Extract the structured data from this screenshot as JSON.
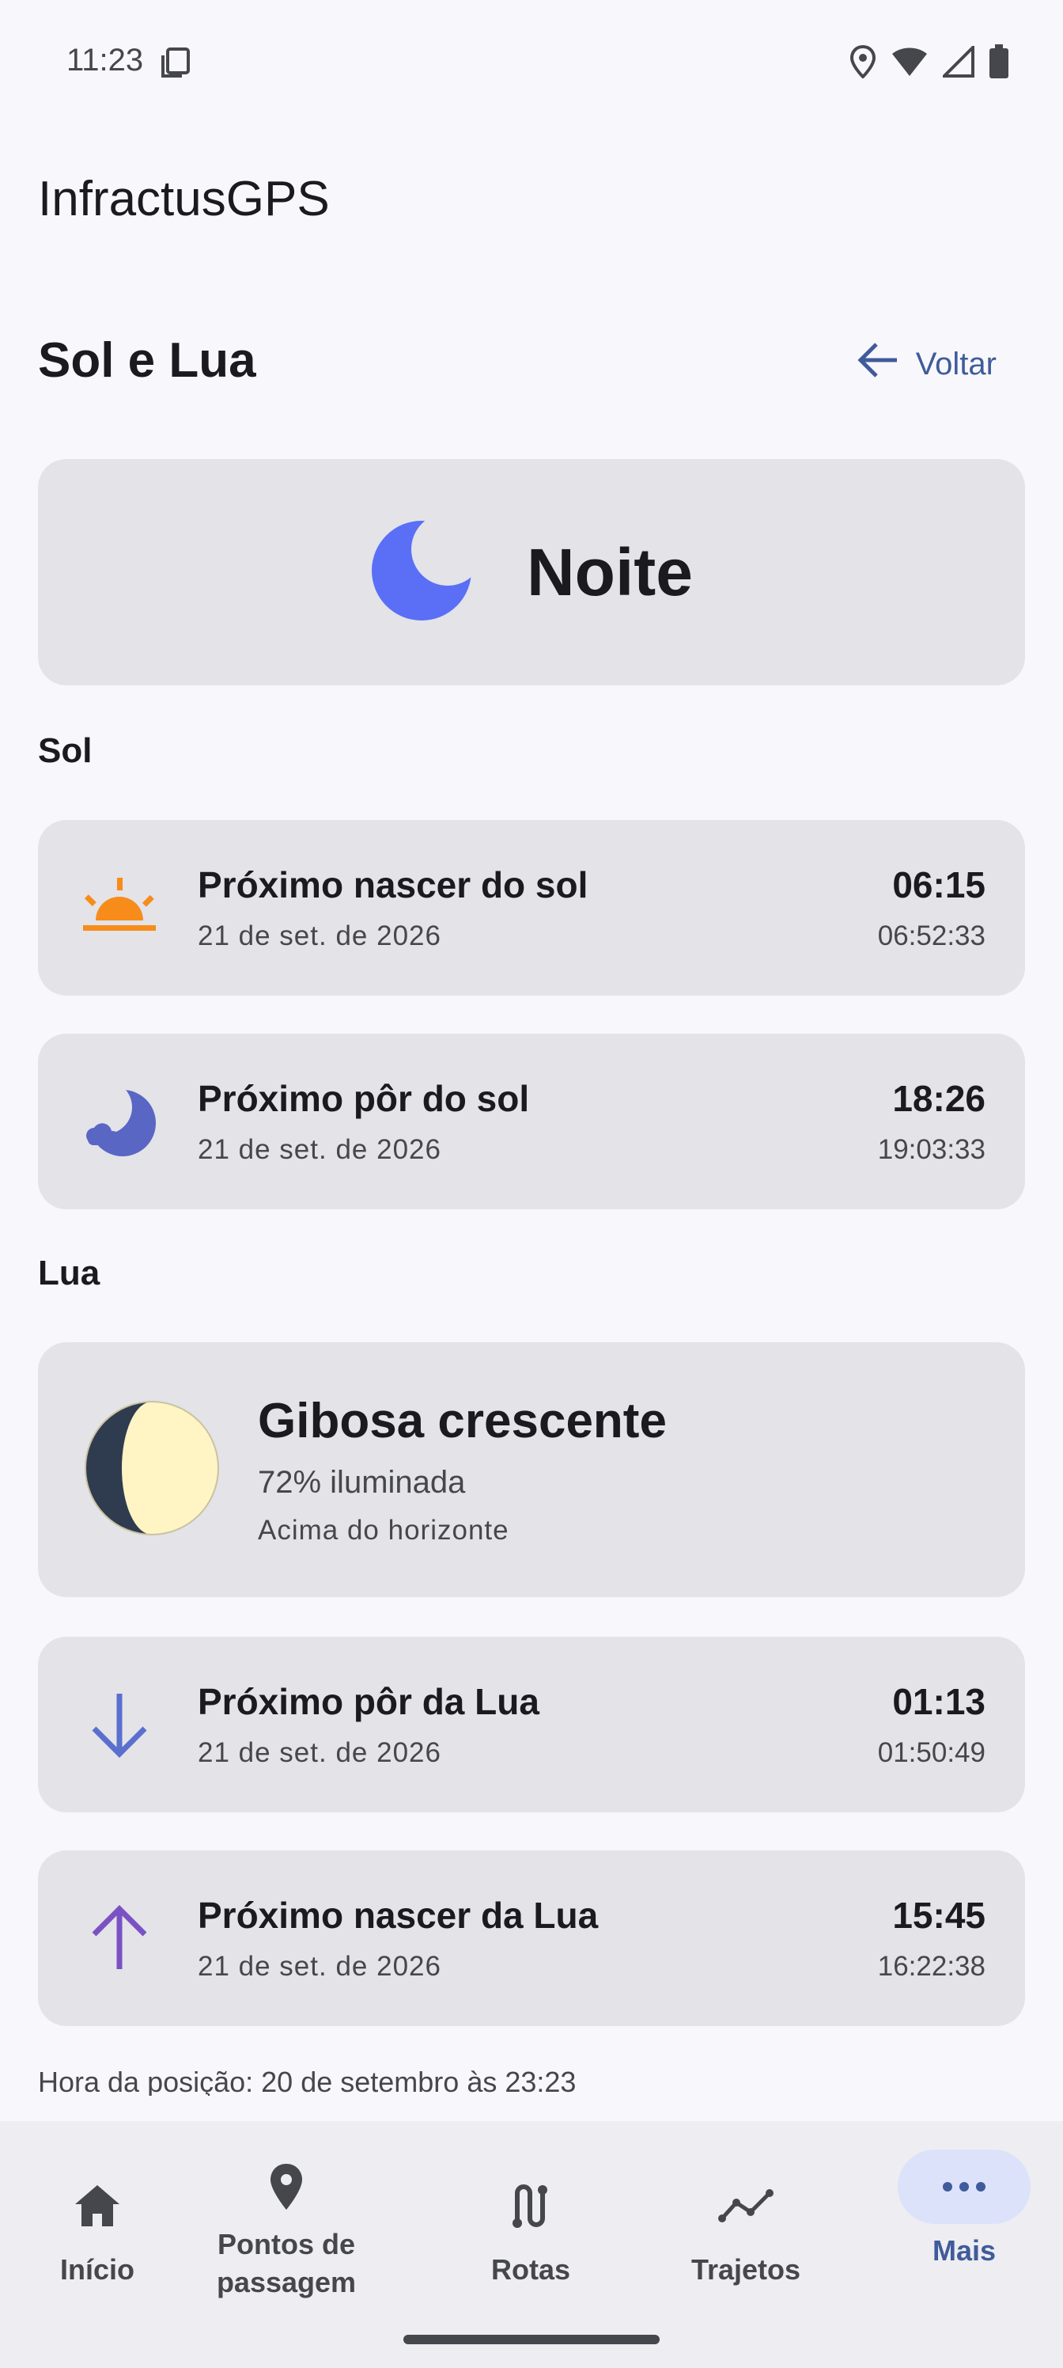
{
  "status": {
    "time": "11:23"
  },
  "app": {
    "title": "InfractusGPS"
  },
  "header": {
    "title": "Sol e Lua",
    "back_label": "Voltar"
  },
  "day_state": {
    "label": "Noite"
  },
  "sun": {
    "section_label": "Sol",
    "items": [
      {
        "title": "Próximo nascer do sol",
        "date": "21 de set. de 2026",
        "time": "06:15",
        "time_secondary": "06:52:33",
        "icon": "sunrise-icon"
      },
      {
        "title": "Próximo pôr do sol",
        "date": "21 de set. de 2026",
        "time": "18:26",
        "time_secondary": "19:03:33",
        "icon": "night-cloud-icon"
      }
    ]
  },
  "moon": {
    "section_label": "Lua",
    "phase": {
      "title": "Gibosa crescente",
      "illumination": "72% iluminada",
      "horizon": "Acima do horizonte",
      "illumination_fraction": 0.72
    },
    "items": [
      {
        "title": "Próximo pôr da Lua",
        "date": "21 de set. de 2026",
        "time": "01:13",
        "time_secondary": "01:50:49",
        "icon": "arrow-down-icon"
      },
      {
        "title": "Próximo nascer da Lua",
        "date": "21 de set. de 2026",
        "time": "15:45",
        "time_secondary": "16:22:38",
        "icon": "arrow-up-icon"
      }
    ]
  },
  "footer": {
    "position_time": "Hora da posição: 20 de setembro às 23:23"
  },
  "nav": {
    "items": [
      {
        "label": "Início",
        "icon": "home-icon"
      },
      {
        "label": "Pontos de passagem",
        "icon": "location-pin-icon"
      },
      {
        "label": "Rotas",
        "icon": "route-icon"
      },
      {
        "label": "Trajetos",
        "icon": "track-icon"
      },
      {
        "label": "Mais",
        "icon": "more-icon",
        "active": true
      }
    ]
  },
  "colors": {
    "accent": "#3f5b9a",
    "night_moon": "#5a6ff5",
    "sunrise": "#f78c1b",
    "sunset_night": "#5a66c4",
    "moon_down": "#5a6fce",
    "moon_up": "#7a52c4"
  }
}
